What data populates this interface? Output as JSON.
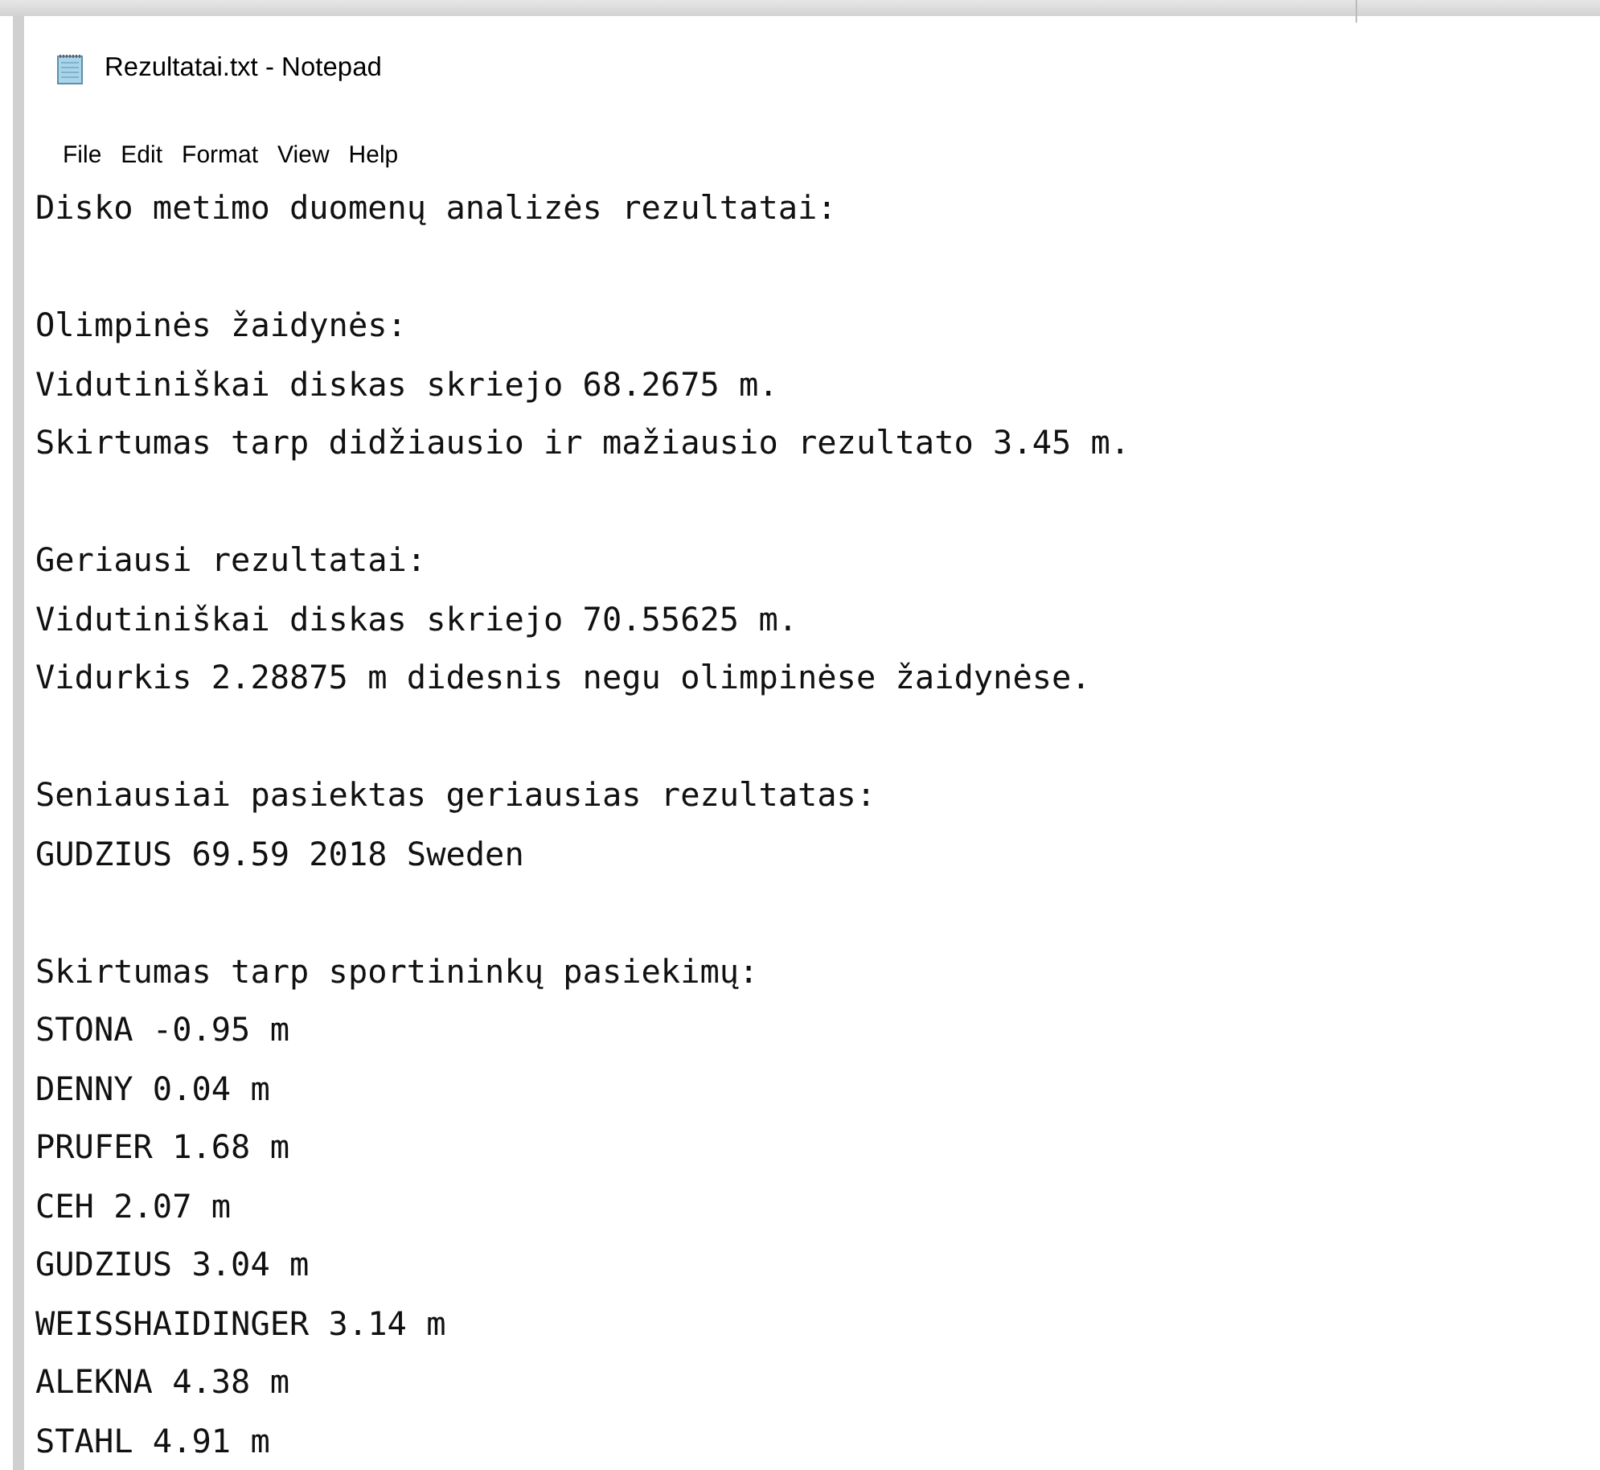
{
  "window": {
    "title": "Rezultatai.txt - Notepad"
  },
  "menu": [
    "File",
    "Edit",
    "Format",
    "View",
    "Help"
  ],
  "document": {
    "paragraphs": [
      [
        "Disko metimo duomenų analizės rezultatai:"
      ],
      [
        "Olimpinės žaidynės:",
        "Vidutiniškai diskas skriejo 68.2675 m.",
        "Skirtumas tarp didžiausio ir mažiausio rezultato 3.45 m."
      ],
      [
        "Geriausi rezultatai:",
        "Vidutiniškai diskas skriejo 70.55625 m.",
        "Vidurkis 2.28875 m didesnis negu olimpinėse žaidynėse."
      ],
      [
        "Seniausiai pasiektas geriausias rezultatas:",
        "GUDZIUS 69.59 2018 Sweden"
      ],
      [
        "Skirtumas tarp sportininkų pasiekimų:",
        "STONA -0.95 m",
        "DENNY 0.04 m",
        "PRUFER 1.68 m",
        "CEH 2.07 m",
        "GUDZIUS 3.04 m",
        "WEISSHAIDINGER 3.14 m",
        "ALEKNA 4.38 m",
        "STAHL 4.91 m"
      ]
    ]
  }
}
